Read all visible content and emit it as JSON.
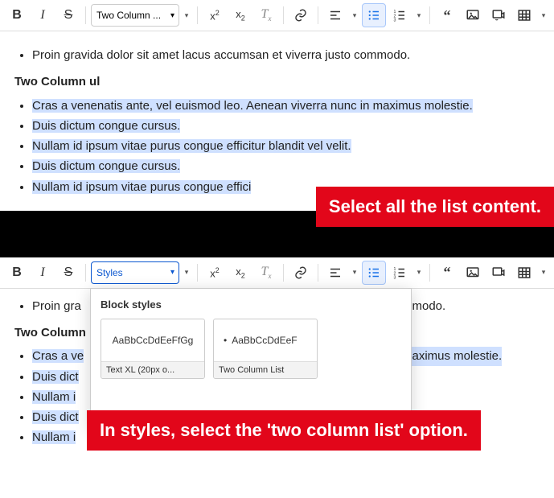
{
  "pane1": {
    "toolbar": {
      "styles_label": "Two Column ...",
      "icons": {
        "bold": "B",
        "italic": "I",
        "strike": "S",
        "sup": "x²",
        "sub": "x₂",
        "clear": "Tₓ",
        "link": "link",
        "align": "align",
        "ul": "ul-active",
        "ol": "ol",
        "quote": "quote",
        "image": "image",
        "widget": "widget",
        "table": "table"
      }
    },
    "content": {
      "truncated_line": "Nullam id ipsum vitae purus congue efficitur blandit vel velit.",
      "line_unselected": "Proin gravida dolor sit amet lacus accumsan et viverra justo commodo.",
      "heading": "Two Column ul",
      "selected": [
        "Cras a venenatis ante, vel euismod leo. Aenean viverra nunc in maximus molestie.",
        "Duis dictum congue cursus.",
        "Nullam id ipsum vitae purus congue efficitur blandit vel velit.",
        "Duis dictum congue cursus.",
        "Nullam id ipsum vitae purus congue effici"
      ]
    },
    "banner": "Select all the list content."
  },
  "pane2": {
    "toolbar": {
      "styles_label": "Styles"
    },
    "content": {
      "line_unselected_left": "Proin gra",
      "line_unselected_right": "mmodo.",
      "heading": "Two Column",
      "selected_left": [
        "Cras a ve",
        "Duis dict",
        "Nullam i",
        "Duis dict",
        "Nullam i"
      ],
      "selected_right_frag": "maximus molestie."
    },
    "popup": {
      "section": "Block styles",
      "card1": {
        "preview": "AaBbCcDdEeFfGg",
        "label": "Text XL (20px o..."
      },
      "card2": {
        "preview": "AaBbCcDdEeF",
        "label": "Two Column List"
      }
    },
    "banner": "In styles, select the 'two column list' option."
  }
}
